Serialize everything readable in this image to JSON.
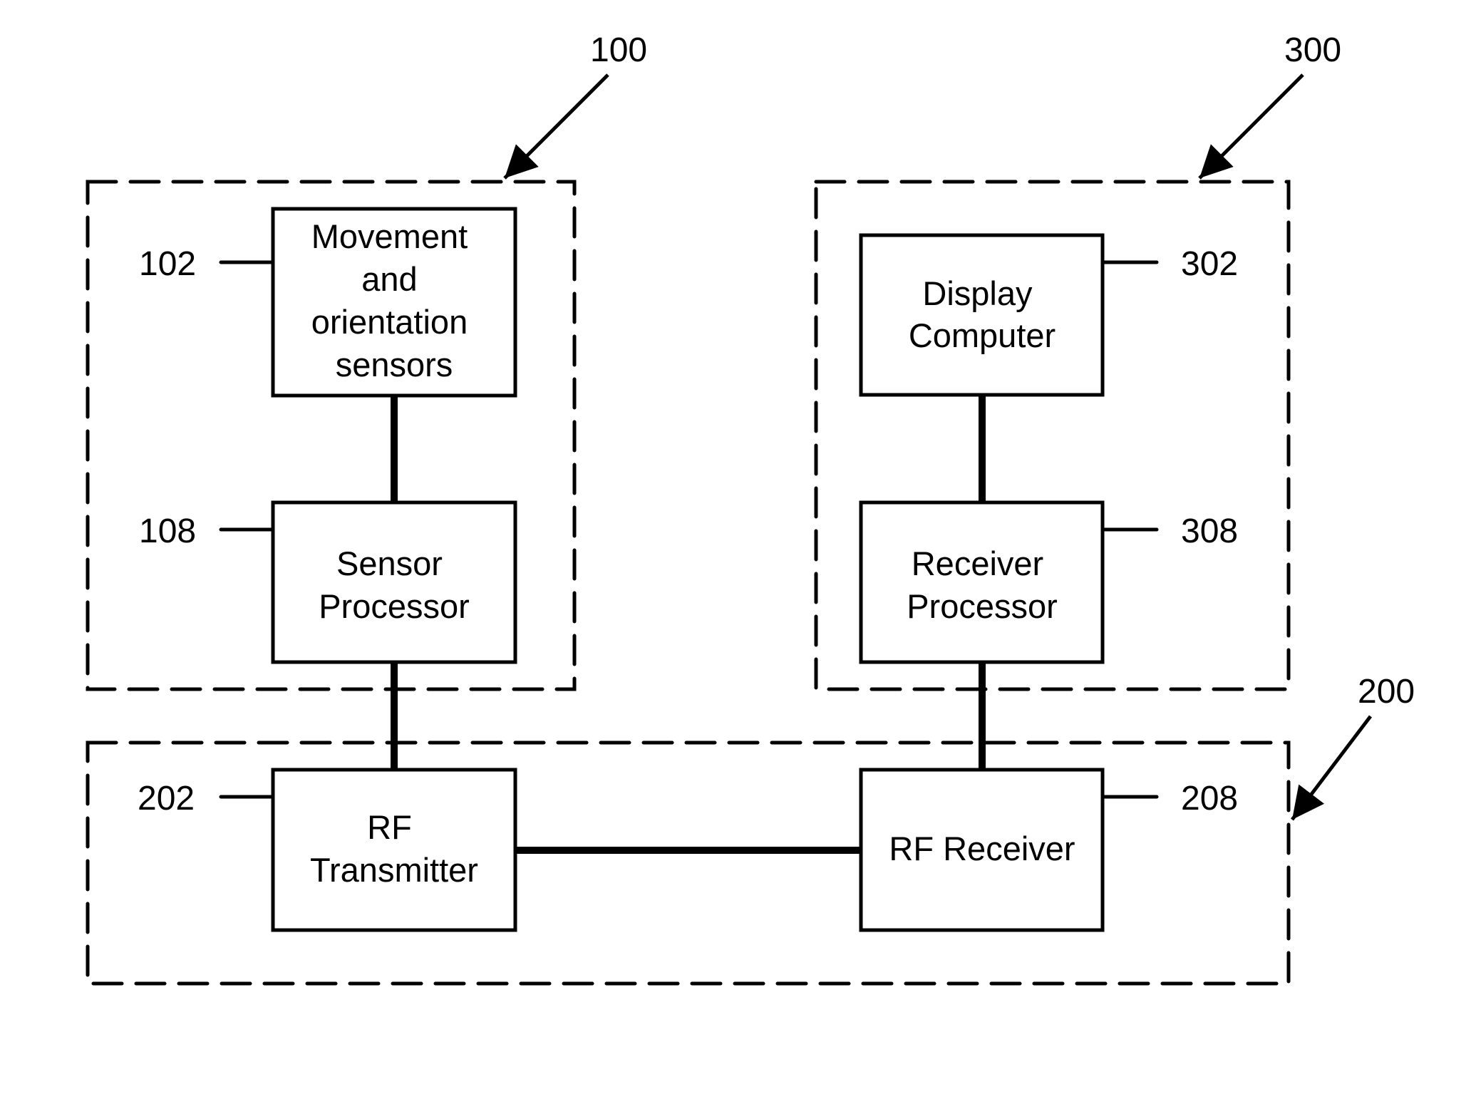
{
  "figure": {
    "groups": [
      {
        "id": "100",
        "ref_label": "100"
      },
      {
        "id": "300",
        "ref_label": "300"
      },
      {
        "id": "200",
        "ref_label": "200"
      }
    ],
    "blocks": [
      {
        "id": "102",
        "ref_label": "102",
        "lines": [
          "Movement",
          "and",
          "orientation",
          "sensors"
        ]
      },
      {
        "id": "108",
        "ref_label": "108",
        "lines": [
          "Sensor",
          "Processor"
        ]
      },
      {
        "id": "302",
        "ref_label": "302",
        "lines": [
          "Display",
          "Computer"
        ]
      },
      {
        "id": "308",
        "ref_label": "308",
        "lines": [
          "Receiver",
          "Processor"
        ]
      },
      {
        "id": "202",
        "ref_label": "202",
        "lines": [
          "RF",
          "Transmitter"
        ]
      },
      {
        "id": "208",
        "ref_label": "208",
        "lines": [
          "RF Receiver"
        ]
      }
    ],
    "connections": [
      {
        "from": "102",
        "to": "108"
      },
      {
        "from": "108",
        "to": "202"
      },
      {
        "from": "202",
        "to": "208"
      },
      {
        "from": "208",
        "to": "308"
      },
      {
        "from": "308",
        "to": "302"
      }
    ],
    "colors": {
      "ink": "#000000",
      "background": "#ffffff"
    }
  }
}
